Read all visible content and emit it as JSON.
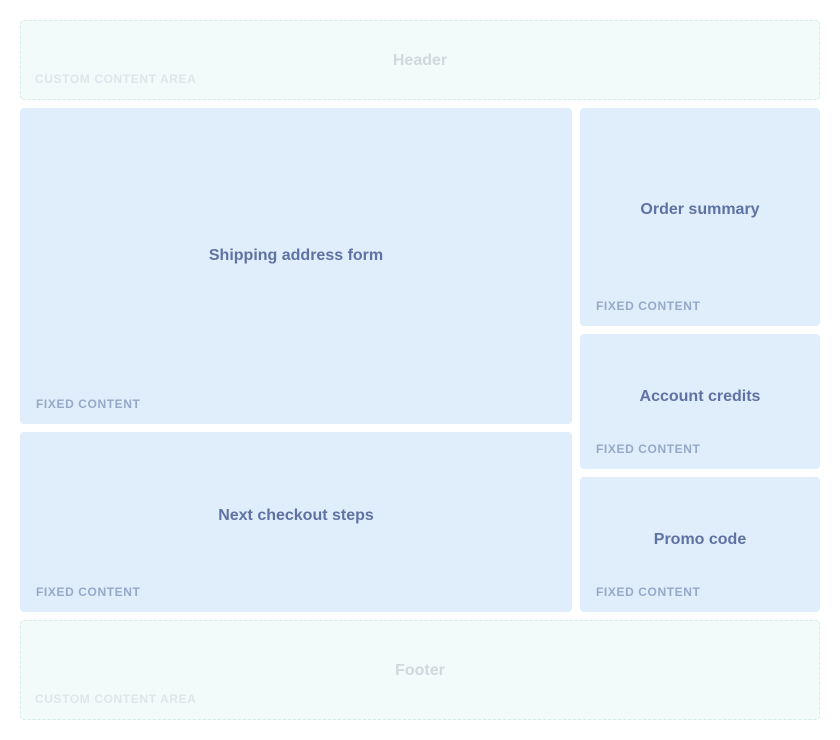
{
  "header": {
    "title": "Header",
    "tag": "CUSTOM CONTENT AREA"
  },
  "main": {
    "shipping": {
      "title": "Shipping address form",
      "tag": "FIXED CONTENT"
    },
    "next_steps": {
      "title": "Next checkout steps",
      "tag": "FIXED CONTENT"
    }
  },
  "sidebar": {
    "order_summary": {
      "title": "Order summary",
      "tag": "FIXED CONTENT"
    },
    "account_credits": {
      "title": "Account credits",
      "tag": "FIXED CONTENT"
    },
    "promo_code": {
      "title": "Promo code",
      "tag": "FIXED CONTENT"
    }
  },
  "footer": {
    "title": "Footer",
    "tag": "CUSTOM CONTENT AREA"
  },
  "colors": {
    "custom_area_bg": "#f2fbfa",
    "custom_area_border": "#d3ede8",
    "fixed_area_bg": "#e0edfb",
    "fixed_title": "#5e73a3",
    "fixed_tag": "#97a9c9"
  }
}
